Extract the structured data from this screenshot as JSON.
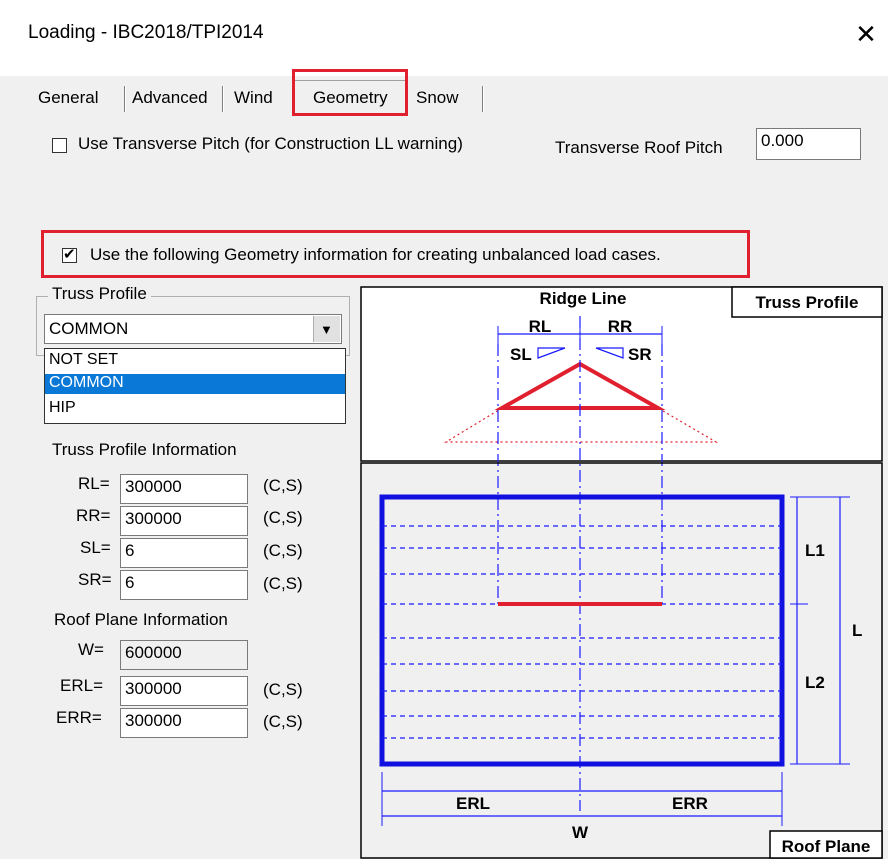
{
  "window": {
    "title": "Loading - IBC2018/TPI2014",
    "close_glyph": "✕"
  },
  "tabs": [
    {
      "label": "General"
    },
    {
      "label": "Advanced"
    },
    {
      "label": "Wind"
    },
    {
      "label": "Geometry",
      "active": true
    },
    {
      "label": "Snow"
    }
  ],
  "transverse": {
    "checkbox_label": "Use Transverse Pitch (for Construction LL warning)",
    "checked": false,
    "pitch_label": "Transverse Roof Pitch",
    "pitch_value": "0.000"
  },
  "geometry_info": {
    "checkbox_label": "Use the following Geometry information for creating unbalanced load cases.",
    "checked": true
  },
  "truss_profile": {
    "group_title": "Truss Profile",
    "selected": "COMMON",
    "options": [
      "NOT SET",
      "COMMON",
      "HIP"
    ]
  },
  "truss_info": {
    "heading": "Truss Profile Information",
    "fields": [
      {
        "label": "RL=",
        "value": "300000",
        "unit": "(C,S)"
      },
      {
        "label": "RR=",
        "value": "300000",
        "unit": "(C,S)"
      },
      {
        "label": "SL=",
        "value": "6",
        "unit": "(C,S)"
      },
      {
        "label": "SR=",
        "value": "6",
        "unit": "(C,S)"
      }
    ]
  },
  "roof_info": {
    "heading": "Roof Plane Information",
    "w_label": "W=",
    "w_value": "600000",
    "fields": [
      {
        "label": "ERL=",
        "value": "300000",
        "unit": "(C,S)"
      },
      {
        "label": "ERR=",
        "value": "300000",
        "unit": "(C,S)"
      }
    ]
  },
  "diagram": {
    "ridge_line": "Ridge Line",
    "truss_profile_box": "Truss Profile",
    "roof_plane_box": "Roof Plane",
    "rl": "RL",
    "rr": "RR",
    "sl": "SL",
    "sr": "SR",
    "l1": "L1",
    "l2": "L2",
    "l": "L",
    "erl": "ERL",
    "err": "ERR",
    "w": "W"
  },
  "colors": {
    "highlight": "#e0202e",
    "plane": "#1010e0",
    "selection": "#0a78d7"
  }
}
